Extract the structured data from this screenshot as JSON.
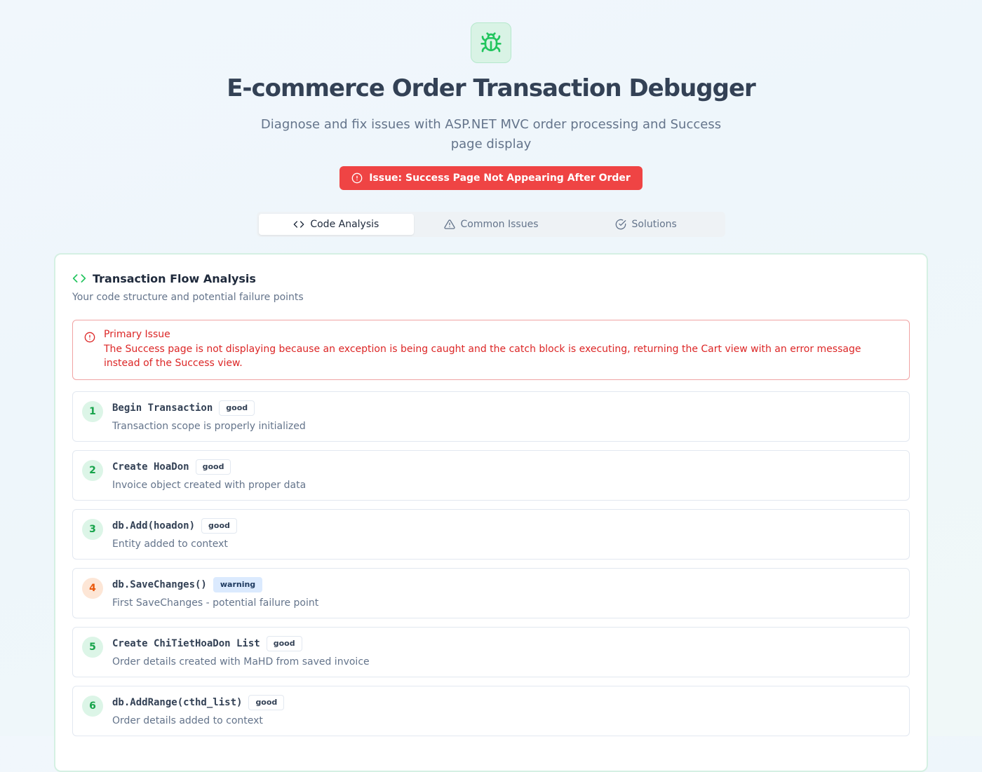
{
  "header": {
    "title": "E-commerce Order Transaction Debugger",
    "subtitle": "Diagnose and fix issues with ASP.NET MVC order processing and Success page display",
    "issue_badge": "Issue: Success Page Not Appearing After Order",
    "logo_icon": "bug-icon"
  },
  "tabs": [
    {
      "label": "Code Analysis",
      "icon": "code-icon",
      "active": true
    },
    {
      "label": "Common Issues",
      "icon": "warning-triangle-icon",
      "active": false
    },
    {
      "label": "Solutions",
      "icon": "check-circle-icon",
      "active": false
    }
  ],
  "card": {
    "title": "Transaction Flow Analysis",
    "description": "Your code structure and potential failure points",
    "alert": {
      "title": "Primary Issue",
      "text": "The Success page is not displaying because an exception is being caught and the catch block is executing, returning the Cart view with an error message instead of the Success view."
    },
    "steps": [
      {
        "num": "1",
        "code": "Begin Transaction",
        "status": "good",
        "desc": "Transaction scope is properly initialized"
      },
      {
        "num": "2",
        "code": "Create HoaDon",
        "status": "good",
        "desc": "Invoice object created with proper data"
      },
      {
        "num": "3",
        "code": "db.Add(hoadon)",
        "status": "good",
        "desc": "Entity added to context"
      },
      {
        "num": "4",
        "code": "db.SaveChanges()",
        "status": "warning",
        "desc": "First SaveChanges - potential failure point"
      },
      {
        "num": "5",
        "code": "Create ChiTietHoaDon List",
        "status": "good",
        "desc": "Order details created with MaHD from saved invoice"
      },
      {
        "num": "6",
        "code": "db.AddRange(cthd_list)",
        "status": "good",
        "desc": "Order details added to context"
      }
    ]
  },
  "colors": {
    "accent_green": "#22c55e",
    "error_red": "#ef4444",
    "warning_orange": "#ea580c"
  }
}
